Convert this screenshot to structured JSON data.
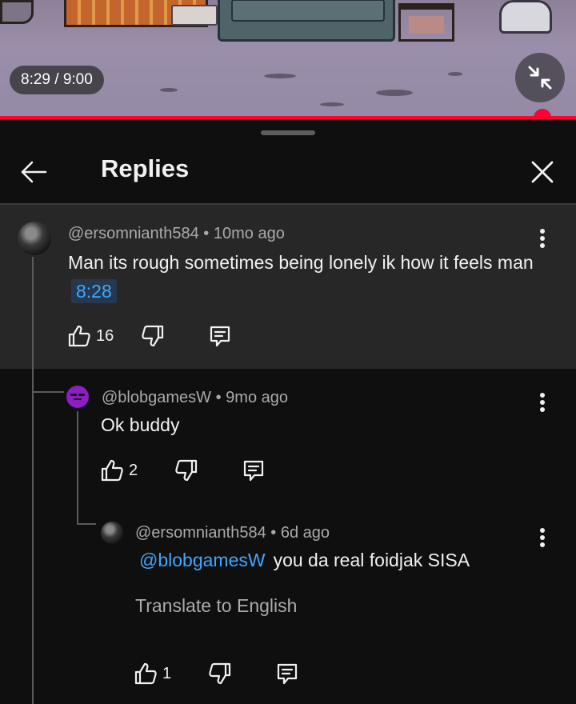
{
  "player": {
    "time_display": "8:29 / 9:00",
    "progress": 0.942,
    "fullscreen_icon": "fullscreen-exit-icon",
    "accent_color": "#ff0033"
  },
  "panel": {
    "title": "Replies",
    "back_icon": "arrow-back-icon",
    "close_icon": "close-icon"
  },
  "comments": [
    {
      "author": "@ersomnianth584",
      "age": "10mo ago",
      "text": "Man its rough sometimes being lonely ik how it feels man",
      "timestamp_link": "8:28",
      "likes": "16"
    },
    {
      "author": "@blobgamesW",
      "age": "9mo ago",
      "text": "Ok buddy",
      "likes": "2"
    },
    {
      "author": "@ersomnianth584",
      "age": "6d ago",
      "mention": "@blobgamesW",
      "text": "you da real foidjak SISA",
      "translate_label": "Translate to English",
      "likes": "1"
    }
  ],
  "separator": " • ",
  "colors": {
    "background": "#0f0f0f",
    "highlight_background": "#272727",
    "link": "#3ea6ff",
    "secondary_text": "#aaaaaa"
  }
}
